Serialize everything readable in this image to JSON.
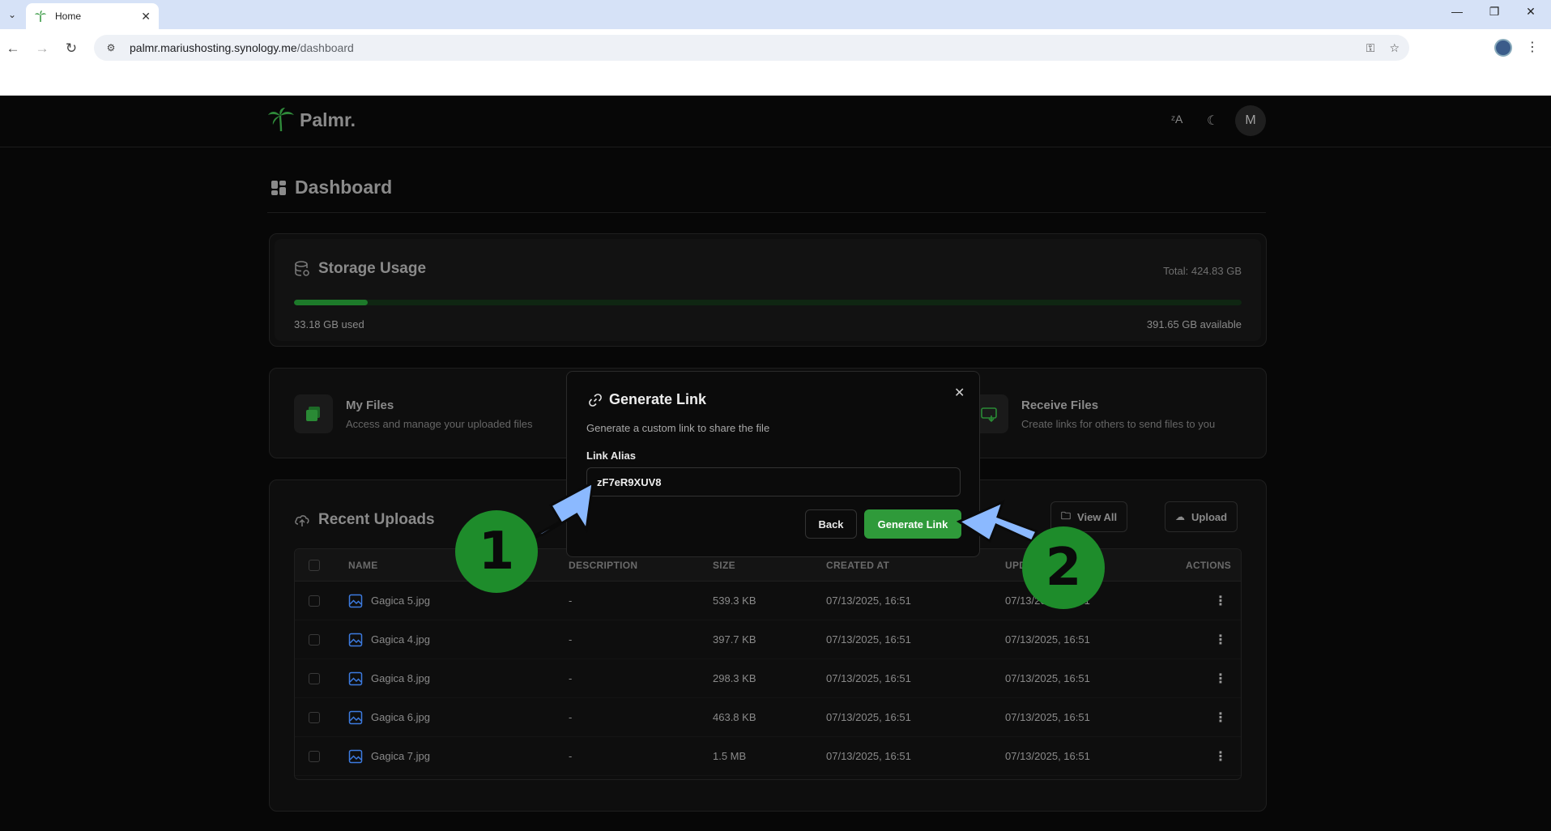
{
  "browser": {
    "tab_title": "Home",
    "url_host": "palmr.mariushosting.synology.me",
    "url_path": "/dashboard"
  },
  "app": {
    "brand": "Palmr.",
    "avatar_initial": "M",
    "page_title": "Dashboard"
  },
  "storage": {
    "title": "Storage Usage",
    "total": "Total: 424.83 GB",
    "used": "33.18 GB used",
    "available": "391.65 GB available",
    "used_fraction": 0.078
  },
  "quick_actions": [
    {
      "title": "My Files",
      "desc": "Access and manage your uploaded files"
    },
    {
      "title": "Receive Files",
      "desc": "Create links for others to send files to you"
    }
  ],
  "recent": {
    "title": "Recent Uploads",
    "view_all": "View All",
    "upload": "Upload",
    "columns": [
      "NAME",
      "DESCRIPTION",
      "SIZE",
      "CREATED AT",
      "UPD",
      "ACTIONS"
    ],
    "rows": [
      {
        "name": "Gagica 5.jpg",
        "desc": "-",
        "size": "539.3 KB",
        "created": "07/13/2025, 16:51",
        "updated": "07/13/2025, 16:51"
      },
      {
        "name": "Gagica 4.jpg",
        "desc": "-",
        "size": "397.7 KB",
        "created": "07/13/2025, 16:51",
        "updated": "07/13/2025, 16:51"
      },
      {
        "name": "Gagica 8.jpg",
        "desc": "-",
        "size": "298.3 KB",
        "created": "07/13/2025, 16:51",
        "updated": "07/13/2025, 16:51"
      },
      {
        "name": "Gagica 6.jpg",
        "desc": "-",
        "size": "463.8 KB",
        "created": "07/13/2025, 16:51",
        "updated": "07/13/2025, 16:51"
      },
      {
        "name": "Gagica 7.jpg",
        "desc": "-",
        "size": "1.5 MB",
        "created": "07/13/2025, 16:51",
        "updated": "07/13/2025, 16:51"
      }
    ]
  },
  "modal": {
    "title": "Generate Link",
    "description": "Generate a custom link to share the file",
    "label": "Link Alias",
    "alias_value": "zF7eR9XUV8",
    "back": "Back",
    "generate": "Generate Link"
  },
  "annotations": {
    "step1": "1",
    "step2": "2"
  },
  "colors": {
    "accent_green": "#2f9a3a",
    "arrow_blue": "#8bb9ff",
    "badge_green": "#1e8c2b"
  }
}
